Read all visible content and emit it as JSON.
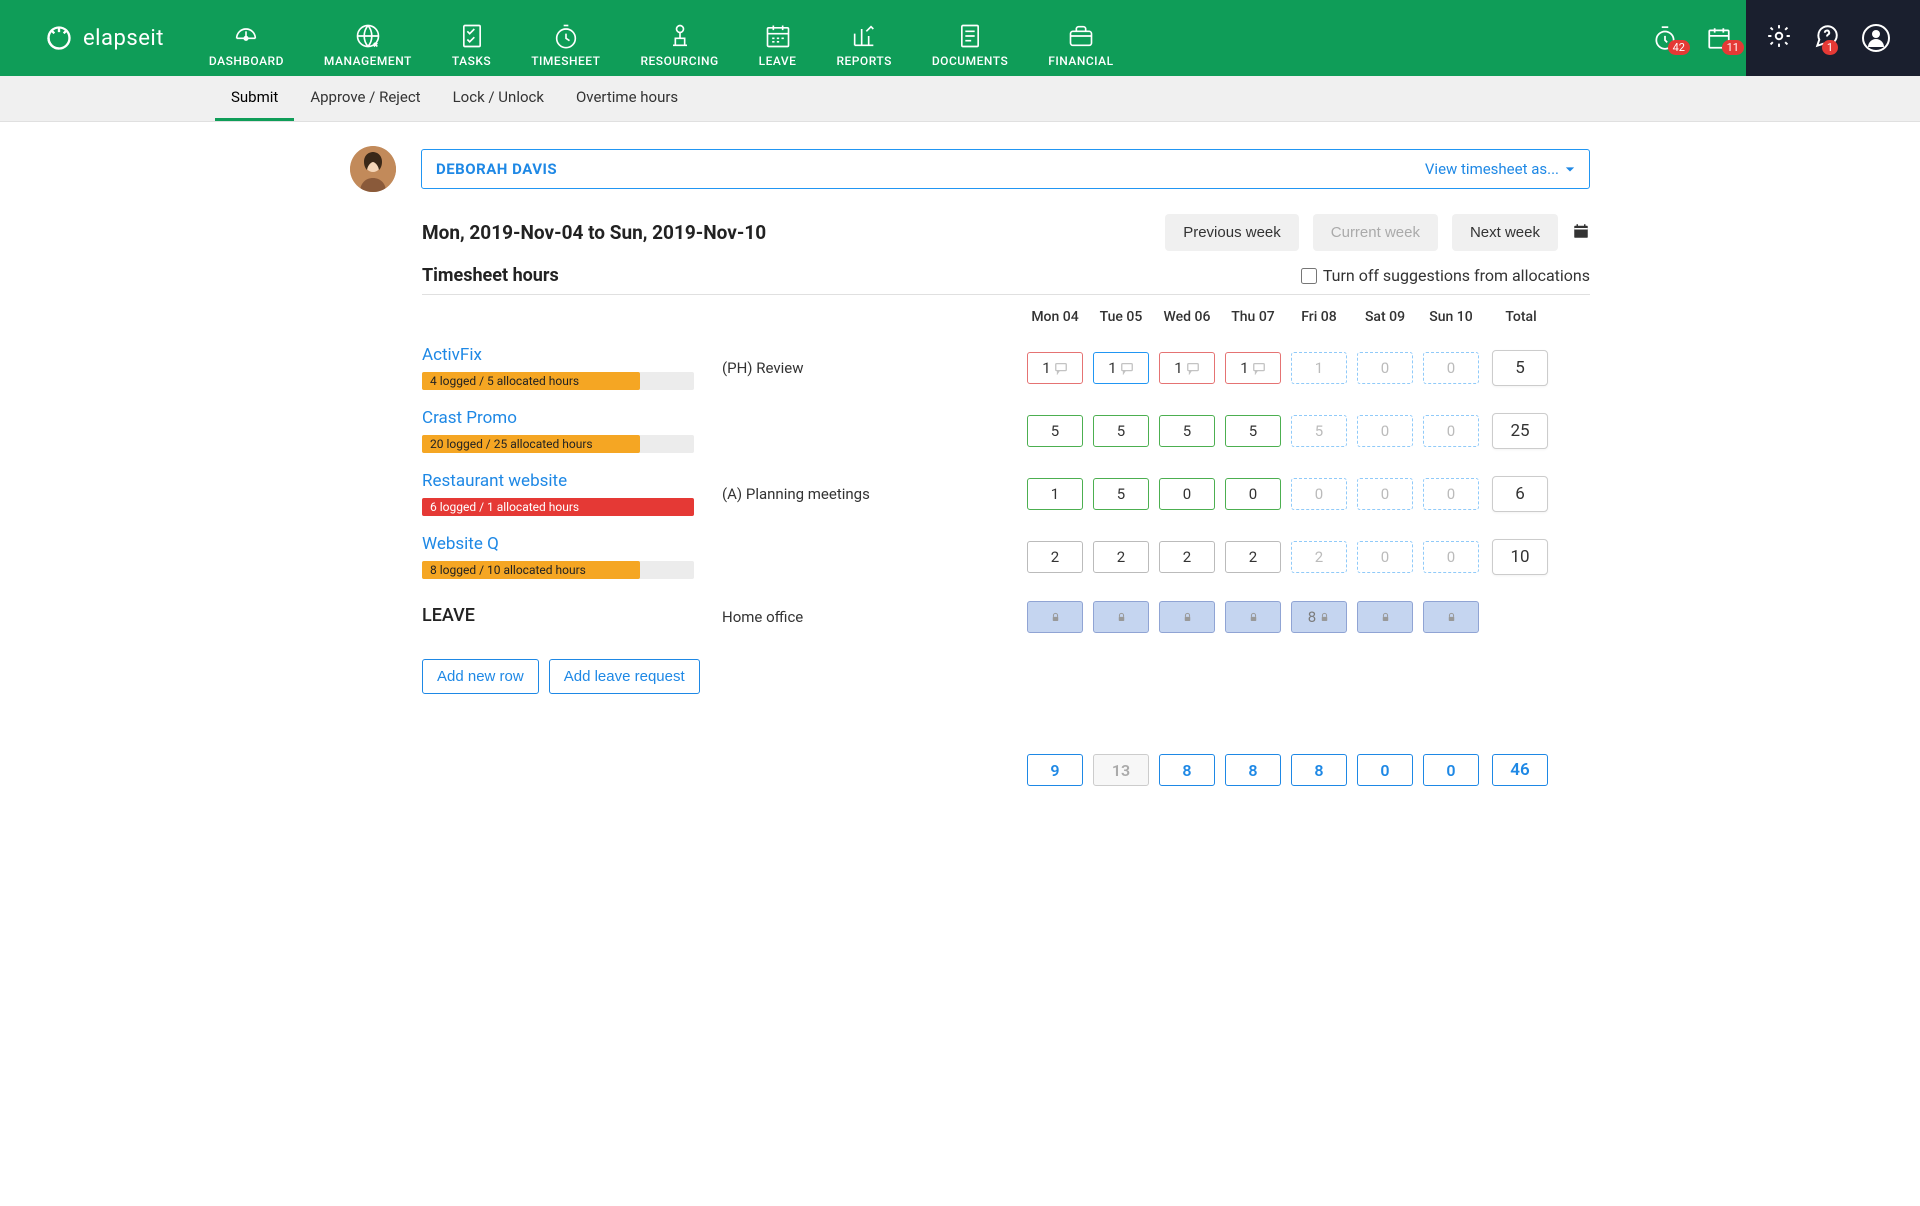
{
  "brand": "elapseit",
  "nav": {
    "items": [
      {
        "label": "DASHBOARD"
      },
      {
        "label": "MANAGEMENT"
      },
      {
        "label": "TASKS"
      },
      {
        "label": "TIMESHEET"
      },
      {
        "label": "RESOURCING"
      },
      {
        "label": "LEAVE"
      },
      {
        "label": "REPORTS"
      },
      {
        "label": "DOCUMENTS"
      },
      {
        "label": "FINANCIAL"
      }
    ],
    "active_index": 3,
    "notif_timer": 42,
    "notif_calendar": 11,
    "notif_help": 1
  },
  "subnav": {
    "tabs": [
      "Submit",
      "Approve / Reject",
      "Lock / Unlock",
      "Overtime hours"
    ],
    "active_index": 0
  },
  "user": {
    "name": "DEBORAH DAVIS",
    "view_link": "View timesheet as..."
  },
  "date_range": "Mon, 2019-Nov-04 to Sun, 2019-Nov-10",
  "week_nav": {
    "prev": "Previous week",
    "current": "Current week",
    "next": "Next week"
  },
  "hours_title": "Timesheet hours",
  "suggestions_label": "Turn off suggestions from allocations",
  "day_headers": [
    "Mon 04",
    "Tue 05",
    "Wed 06",
    "Thu 07",
    "Fri 08",
    "Sat 09",
    "Sun 10"
  ],
  "total_header": "Total",
  "rows": [
    {
      "project": "ActivFix",
      "task": "(PH) Review",
      "progress_label": "4 logged / 5 allocated hours",
      "progress_pct": 80,
      "bar_color": "orange",
      "cells": [
        {
          "val": "1",
          "type": "overtime",
          "chat": true
        },
        {
          "val": "1",
          "type": "selected",
          "chat": true
        },
        {
          "val": "1",
          "type": "overtime",
          "chat": true
        },
        {
          "val": "1",
          "type": "overtime",
          "chat": true
        },
        {
          "val": "1",
          "type": "suggestion"
        },
        {
          "val": "0",
          "type": "suggestion"
        },
        {
          "val": "0",
          "type": "suggestion"
        }
      ],
      "total": "5"
    },
    {
      "project": "Crast Promo",
      "task": "",
      "progress_label": "20 logged / 25 allocated hours",
      "progress_pct": 80,
      "bar_color": "orange",
      "cells": [
        {
          "val": "5",
          "type": "logged"
        },
        {
          "val": "5",
          "type": "logged"
        },
        {
          "val": "5",
          "type": "logged"
        },
        {
          "val": "5",
          "type": "logged"
        },
        {
          "val": "5",
          "type": "suggestion"
        },
        {
          "val": "0",
          "type": "suggestion"
        },
        {
          "val": "0",
          "type": "suggestion"
        }
      ],
      "total": "25"
    },
    {
      "project": "Restaurant website",
      "task": "(A) Planning meetings",
      "progress_label": "6 logged / 1 allocated hours",
      "progress_pct": 100,
      "bar_color": "red",
      "cells": [
        {
          "val": "1",
          "type": "logged"
        },
        {
          "val": "5",
          "type": "logged"
        },
        {
          "val": "0",
          "type": "logged"
        },
        {
          "val": "0",
          "type": "logged"
        },
        {
          "val": "0",
          "type": "suggestion"
        },
        {
          "val": "0",
          "type": "suggestion"
        },
        {
          "val": "0",
          "type": "suggestion"
        }
      ],
      "total": "6"
    },
    {
      "project": "Website Q",
      "task": "",
      "progress_label": "8 logged / 10 allocated hours",
      "progress_pct": 80,
      "bar_color": "orange",
      "cells": [
        {
          "val": "2",
          "type": "neutral"
        },
        {
          "val": "2",
          "type": "neutral"
        },
        {
          "val": "2",
          "type": "neutral"
        },
        {
          "val": "2",
          "type": "neutral"
        },
        {
          "val": "2",
          "type": "suggestion"
        },
        {
          "val": "0",
          "type": "suggestion"
        },
        {
          "val": "0",
          "type": "suggestion"
        }
      ],
      "total": "10"
    }
  ],
  "leave_row": {
    "name": "LEAVE",
    "task": "Home office",
    "cells": [
      {
        "type": "leave",
        "lock": true
      },
      {
        "type": "leave",
        "lock": true
      },
      {
        "type": "leave",
        "lock": true
      },
      {
        "type": "leave",
        "lock": true
      },
      {
        "val": "8",
        "type": "leave",
        "lock": true
      },
      {
        "type": "leave",
        "lock": true
      },
      {
        "type": "leave",
        "lock": true
      }
    ]
  },
  "buttons": {
    "add_row": "Add new row",
    "add_leave": "Add leave request"
  },
  "summary": {
    "cells": [
      "9",
      "13",
      "8",
      "8",
      "8",
      "0",
      "0"
    ],
    "muted_index": 1,
    "total": "46"
  }
}
